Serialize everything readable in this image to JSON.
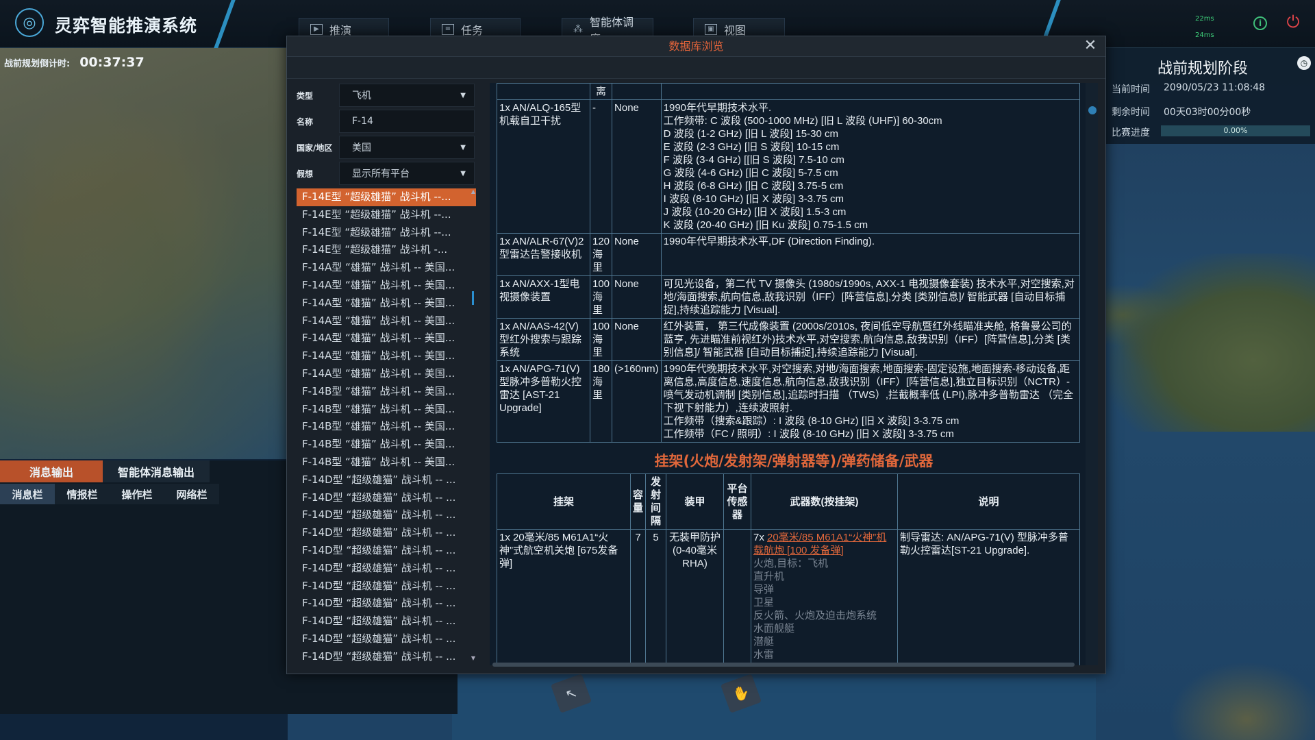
{
  "app": {
    "title": "灵弈智能推演系统"
  },
  "nav": {
    "tabs": [
      {
        "label": "推演",
        "icon": "film-icon"
      },
      {
        "label": "任务",
        "icon": "task-list-icon"
      },
      {
        "label": "智能体调度",
        "icon": "network-icon"
      },
      {
        "label": "视图",
        "icon": "image-icon"
      }
    ],
    "ping": [
      "22ms",
      "24ms"
    ]
  },
  "countdown": {
    "label": "战前规划倒计时:",
    "time": "00:37:37"
  },
  "status": {
    "phase": "战前规划阶段",
    "current_time_label": "当前时间",
    "current_time": "2090/05/23 11:08:48",
    "remaining_label": "剩余时间",
    "remaining": "00天03时00分00秒",
    "progress_label": "比赛进度",
    "progress_text": "0.00%",
    "progress_fraction": 0.0
  },
  "messages": {
    "tabs": [
      "消息输出",
      "智能体消息输出"
    ],
    "subtabs": [
      "消息栏",
      "情报栏",
      "操作栏",
      "网络栏"
    ]
  },
  "modal": {
    "title": "数据库浏览",
    "filters": [
      {
        "label": "类型",
        "value": "飞机",
        "dropdown": true
      },
      {
        "label": "名称",
        "value": "F-14",
        "dropdown": false
      },
      {
        "label": "国家/地区",
        "value": "美国",
        "dropdown": true
      },
      {
        "label": "假想",
        "value": "显示所有平台",
        "dropdown": true
      }
    ],
    "list": [
      "F-14E型 “超级雄猫” 战斗机 --...",
      "F-14E型 “超级雄猫” 战斗机 --...",
      "F-14E型 “超级雄猫” 战斗机 --...",
      "F-14E型 “超级雄猫” 战斗机 -...",
      "F-14A型 “雄猫” 战斗机 -- 美国...",
      "F-14A型 “雄猫” 战斗机 -- 美国...",
      "F-14A型 “雄猫” 战斗机 -- 美国...",
      "F-14A型 “雄猫” 战斗机 -- 美国...",
      "F-14A型 “雄猫” 战斗机 -- 美国...",
      "F-14A型 “雄猫” 战斗机 -- 美国...",
      "F-14A型 “雄猫” 战斗机 -- 美国...",
      "F-14B型 “雄猫” 战斗机 -- 美国...",
      "F-14B型 “雄猫” 战斗机 -- 美国...",
      "F-14B型 “雄猫” 战斗机 -- 美国...",
      "F-14B型 “雄猫” 战斗机 -- 美国...",
      "F-14B型 “雄猫” 战斗机 -- 美国...",
      "F-14D型 “超级雄猫” 战斗机 -- ...",
      "F-14D型 “超级雄猫” 战斗机 -- ...",
      "F-14D型 “超级雄猫” 战斗机 -- ...",
      "F-14D型 “超级雄猫” 战斗机 -- ...",
      "F-14D型 “超级雄猫” 战斗机 -- ...",
      "F-14D型 “超级雄猫” 战斗机 -- ...",
      "F-14D型 “超级雄猫” 战斗机 -- ...",
      "F-14D型 “超级雄猫” 战斗机 -- ...",
      "F-14D型 “超级雄猫” 战斗机 -- ...",
      "F-14D型 “超级雄猫” 战斗机 -- ...",
      "F-14D型 “超级雄猫” 战斗机 -- ..."
    ],
    "selected_index": 0,
    "sensors_header_fragment": "离",
    "sensors": [
      {
        "name": "1x AN/ALQ-165型机载自卫干扰",
        "range": "-",
        "col3": "None",
        "desc": [
          "1990年代早期技术水平.",
          "工作频带: C 波段 (500-1000 MHz) [旧 L 波段 (UHF)] 60-30cm",
          "D 波段 (1-2 GHz) [旧 L 波段] 15-30 cm",
          "E 波段 (2-3 GHz) [旧 S 波段] 10-15 cm",
          "F 波段 (3-4 GHz) [[旧 S 波段] 7.5-10 cm",
          "G 波段 (4-6 GHz) [旧 C 波段] 5-7.5 cm",
          "H 波段 (6-8 GHz) [旧 C 波段] 3.75-5 cm",
          "I 波段 (8-10 GHz) [旧 X 波段] 3-3.75 cm",
          "J 波段 (10-20 GHz) [旧 X 波段] 1.5-3 cm",
          "K 波段 (20-40 GHz) [旧 Ku 波段] 0.75-1.5 cm"
        ]
      },
      {
        "name": "1x AN/ALR-67(V)2型雷达告警接收机",
        "range": "120海里",
        "col3": "None",
        "desc": [
          "1990年代早期技术水平,DF (Direction Finding)."
        ]
      },
      {
        "name": "1x AN/AXX-1型电视摄像装置",
        "range": "100海里",
        "col3": "None",
        "desc": [
          "可见光设备，第二代 TV 摄像头 (1980s/1990s, AXX-1 电视摄像套装) 技术水平,对空搜索,对地/海面搜索,航向信息,敌我识别（IFF）[阵营信息],分类 [类别信息]/ 智能武器 [自动目标捕捉],持续追踪能力 [Visual]."
        ]
      },
      {
        "name": "1x AN/AAS-42(V)型红外搜索与跟踪系统",
        "range": "100海里",
        "col3": "None",
        "desc": [
          "红外装置， 第三代成像装置 (2000s/2010s, 夜间低空导航暨红外线瞄准夹舱, 格鲁曼公司的蓝亨, 先进瞄准前视红外)技术水平,对空搜索,航向信息,敌我识别（IFF）[阵营信息],分类 [类别信息]/ 智能武器 [自动目标捕捉],持续追踪能力 [Visual]."
        ]
      },
      {
        "name": "1x AN/APG-71(V)型脉冲多普勒火控雷达 [AST-21 Upgrade]",
        "range": "180海里",
        "col3": "(>160nm)",
        "desc": [
          "1990年代晚期技术水平,对空搜索,对地/海面搜索,地面搜索-固定设施,地面搜索-移动设备,距离信息,高度信息,速度信息,航向信息,敌我识别（IFF）[阵营信息],独立目标识别（NCTR）- 喷气发动机调制 [类别信息],追踪时扫描 （TWS）,拦截概率低 (LPI),脉冲多普勒雷达 （完全下视下射能力）,连续波照射.",
          "工作频带（搜索&跟踪）: I 波段 (8-10 GHz) [旧 X 波段] 3-3.75 cm",
          "工作频带（FC / 照明）: I 波段 (8-10 GHz) [旧 X 波段] 3-3.75 cm"
        ]
      }
    ],
    "weapons_section_title": "挂架(火炮/发射架/弹射器等)/弹药储备/武器",
    "weapons_headers": [
      "挂架",
      "容量",
      "发射间隔",
      "装甲",
      "平台传感器",
      "武器数(按挂架)",
      "说明"
    ],
    "weapons_row": {
      "mount": "1x 20毫米/85 M61A1“火神”式航空机关炮 [675发备弹]",
      "capacity": "7",
      "interval": "5",
      "armor": "无装甲防护 (0-40毫米 RHA)",
      "sensor": "",
      "weapon_prefix": "7x ",
      "weapon_link": "20毫米/85 M61A1“火神”机载航炮 [100 发备弹]",
      "weapon_targets": [
        "火炮,目标：飞机",
        "直升机",
        "导弹",
        "卫星",
        "反火箭、火炮及迫击炮系统",
        "水面舰艇",
        "潜艇",
        "水雷"
      ],
      "note": "制导雷达: AN/APG-71(V) 型脉冲多普勒火控雷达[ST-21 Upgrade]."
    }
  }
}
